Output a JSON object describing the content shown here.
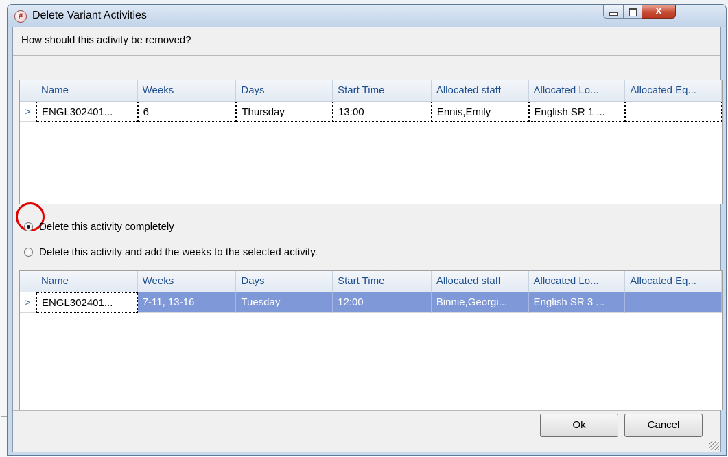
{
  "window": {
    "title": "Delete Variant Activities",
    "buttons": {
      "minimize": "minimize",
      "maximize": "maximize",
      "close": "X"
    }
  },
  "question": "How should this activity be removed?",
  "columns": [
    "Name",
    "Weeks",
    "Days",
    "Start Time",
    "Allocated staff",
    "Allocated Lo...",
    "Allocated Eq..."
  ],
  "activity_to_remove": {
    "row_indicator": ">",
    "name": "ENGL302401...",
    "weeks": "6",
    "days": "Thursday",
    "start_time": "13:00",
    "staff": "Ennis,Emily",
    "location": "English SR 1 ...",
    "equipment": ""
  },
  "options": {
    "delete_completely": "Delete this activity completely",
    "delete_and_add": "Delete this activity and add the weeks to the selected activity.",
    "selected": "delete_completely"
  },
  "target_activity": {
    "row_indicator": ">",
    "name": "ENGL302401...",
    "weeks": "7-11, 13-16",
    "days": "Tuesday",
    "start_time": "12:00",
    "staff": "Binnie,Georgi...",
    "location": "English SR 3 ...",
    "equipment": ""
  },
  "buttons": {
    "ok": "Ok",
    "cancel": "Cancel"
  },
  "colors": {
    "selection_highlight": "#7f98d8",
    "header_text": "#1f4f8f",
    "annotation": "#e00000"
  }
}
